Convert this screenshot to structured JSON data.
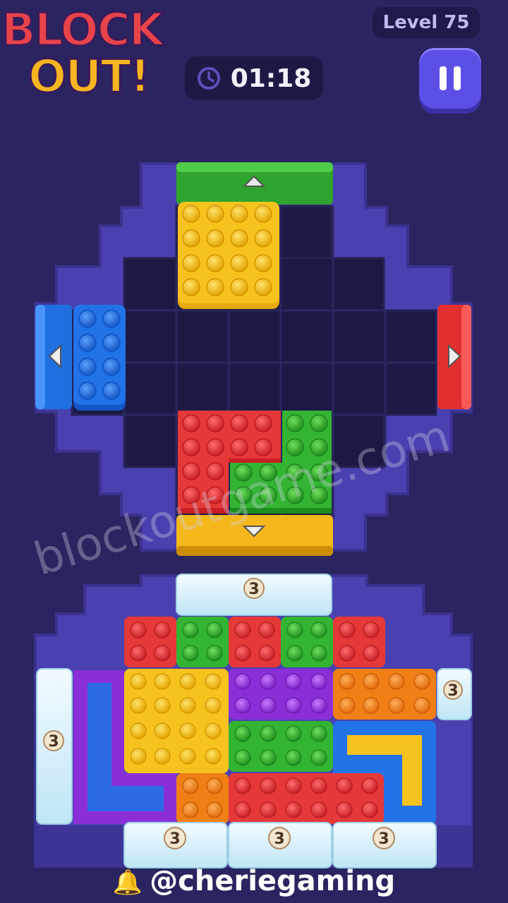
{
  "game": {
    "logo_line1": "BLOCK",
    "logo_line2": "OUT!",
    "level_label": "Level 75",
    "timer": "01:18",
    "pause_icon": "pause-icon",
    "clock_icon": "clock-icon"
  },
  "exits": [
    {
      "side": "top",
      "color": "#2ea32d",
      "arrow": "up"
    },
    {
      "side": "left",
      "color": "#1f6fe0",
      "arrow": "left"
    },
    {
      "side": "right",
      "color": "#e23030",
      "arrow": "right"
    },
    {
      "side": "bottom",
      "color": "#f4b81c",
      "arrow": "down"
    }
  ],
  "board_blocks": [
    {
      "name": "yellow-square-block",
      "color": "#f6c21e"
    },
    {
      "name": "blue-vertical-block",
      "color": "#2272e8"
    },
    {
      "name": "red-l-block",
      "color": "#e53838"
    },
    {
      "name": "green-l-block",
      "color": "#34b433"
    }
  ],
  "queue_blocks": [
    {
      "name": "frozen-top-block",
      "counter": "3"
    },
    {
      "name": "frozen-left-block",
      "counter": "3"
    },
    {
      "name": "frozen-right-block",
      "counter": "3"
    },
    {
      "name": "frozen-bottom-block-1",
      "counter": "3"
    },
    {
      "name": "frozen-bottom-block-2",
      "counter": "3"
    },
    {
      "name": "frozen-bottom-block-3",
      "counter": "3"
    }
  ],
  "watermark": "blockoutgame.com",
  "handle": "@cheriegaming",
  "bell_icon": "bell-icon"
}
